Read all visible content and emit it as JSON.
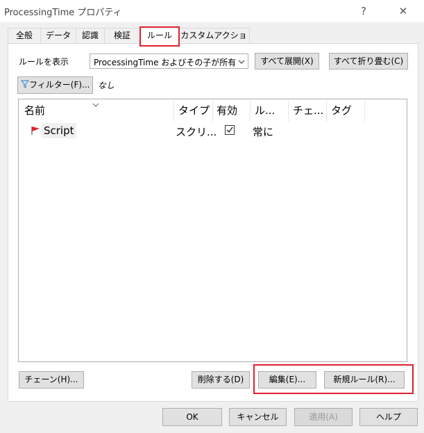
{
  "window": {
    "title": "ProcessingTime プロパティ",
    "help_label": "?",
    "close_label": "✕"
  },
  "tabs": [
    {
      "label": "全般"
    },
    {
      "label": "データ"
    },
    {
      "label": "認識"
    },
    {
      "label": "検証"
    },
    {
      "label": "ルール",
      "active": true
    },
    {
      "label": "カスタムアクション"
    }
  ],
  "rules": {
    "show_label": "ルールを表示",
    "scope_value": "ProcessingTime およびその子が所有",
    "expand_all": "すべて展開(X)",
    "collapse_all": "すべて折り畳む(C)",
    "filter_button": "フィルター(F)...",
    "filter_value": "なし",
    "columns": [
      "名前",
      "タイプ",
      "有効",
      "ル...",
      "チェ...",
      "タグ"
    ],
    "rows": [
      {
        "name": "Script",
        "type": "スクリ...",
        "enabled": true,
        "rule_when": "常に",
        "flag_color": "#e02030"
      }
    ],
    "chain_button": "チェーン(H)...",
    "delete_button": "削除する(D)",
    "edit_button": "編集(E)...",
    "new_rule_button": "新規ルール(R)..."
  },
  "footer": {
    "ok": "OK",
    "cancel": "キャンセル",
    "apply": "適用(A)",
    "help": "ヘルプ"
  },
  "colors": {
    "highlight_red": "#e02030"
  }
}
